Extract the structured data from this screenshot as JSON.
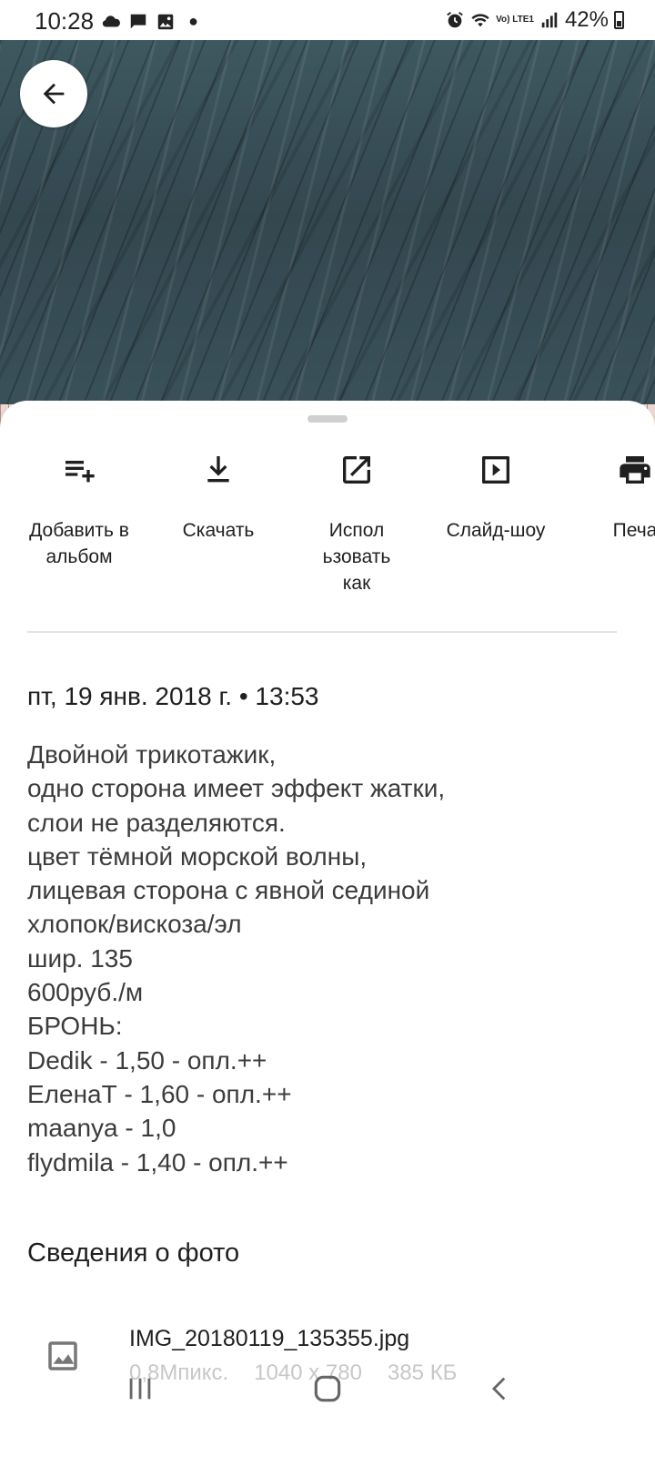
{
  "status": {
    "time": "10:28",
    "battery_text": "42%",
    "network_label": "Vo) LTE1",
    "left_icons": [
      "cloud-icon",
      "message-icon",
      "image-icon",
      "dot-icon"
    ],
    "right_icons": [
      "alarm-icon",
      "wifi-icon",
      "volte-icon",
      "signal-icon",
      "battery-icon"
    ]
  },
  "photo": {
    "back_icon": "arrow-back-icon"
  },
  "actions": [
    {
      "label": "Добавить в альбом",
      "icon": "playlist-add-icon"
    },
    {
      "label": "Скачать",
      "icon": "download-icon"
    },
    {
      "label": "Испол ьзовать как",
      "icon": "open-in-new-icon"
    },
    {
      "label": "Слайд-шоу",
      "icon": "slideshow-icon"
    },
    {
      "label": "Печа",
      "icon": "print-icon"
    }
  ],
  "date_line": "пт, 19 янв. 2018 г. • 13:53",
  "description_lines": [
    "Двойной трикотажик,",
    "одно сторона имеет эффект жатки,",
    "слои не разделяются.",
    "цвет тёмной морской волны,",
    "лицевая сторона с явной сединой",
    "хлопок/вискоза/эл",
    "шир. 135",
    "600руб./м",
    "БРОНЬ:",
    "Dedik - 1,50 - опл.++",
    "ЕленаТ - 1,60 - опл.++",
    "maanya - 1,0",
    "flydmila - 1,40 - опл.++"
  ],
  "details": {
    "title": "Сведения о фото",
    "file_name": "IMG_20180119_135355.jpg",
    "megapixels": "0,8Мпикс.",
    "resolution": "1040 x 780",
    "size": "385 КБ",
    "icon": "image-file-icon"
  },
  "nav": {
    "icons": [
      "recents-icon",
      "home-icon",
      "back-icon"
    ]
  }
}
